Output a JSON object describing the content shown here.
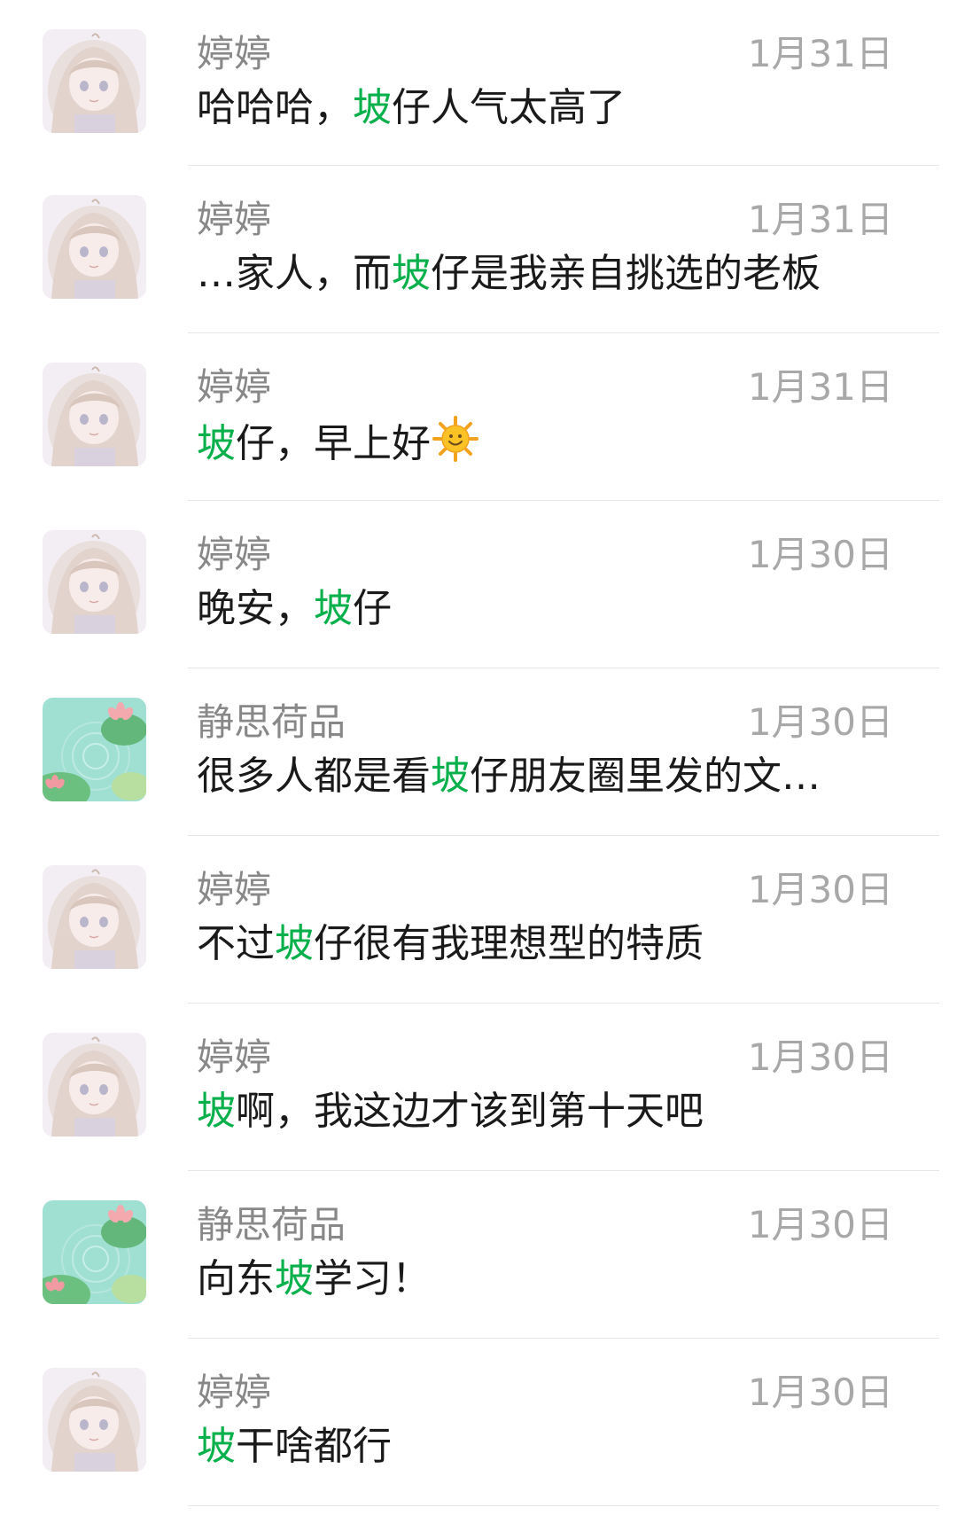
{
  "colors": {
    "highlight": "#07b04a",
    "name_text": "#888888",
    "date_text": "#a8a8a8",
    "message_text": "#1a1a1a",
    "divider": "#e6e6e6"
  },
  "results": [
    {
      "name": "婷婷",
      "date": "1月31日",
      "avatar": "girl-avatar-icon",
      "pre": "哈哈哈，",
      "hl": "坡",
      "post": "仔人气太高了",
      "emoji": ""
    },
    {
      "name": "婷婷",
      "date": "1月31日",
      "avatar": "girl-avatar-icon",
      "pre": "…家人，而",
      "hl": "坡",
      "post": "仔是我亲自挑选的老板",
      "emoji": ""
    },
    {
      "name": "婷婷",
      "date": "1月31日",
      "avatar": "girl-avatar-icon",
      "pre": "",
      "hl": "坡",
      "post": "仔，早上好",
      "emoji": "sun-with-face-icon"
    },
    {
      "name": "婷婷",
      "date": "1月30日",
      "avatar": "girl-avatar-icon",
      "pre": "晚安，",
      "hl": "坡",
      "post": "仔",
      "emoji": ""
    },
    {
      "name": "静思荷品",
      "date": "1月30日",
      "avatar": "lotus-avatar-icon",
      "pre": "很多人都是看",
      "hl": "坡",
      "post": "仔朋友圈里发的文…",
      "emoji": ""
    },
    {
      "name": "婷婷",
      "date": "1月30日",
      "avatar": "girl-avatar-icon",
      "pre": "不过",
      "hl": "坡",
      "post": "仔很有我理想型的特质",
      "emoji": ""
    },
    {
      "name": "婷婷",
      "date": "1月30日",
      "avatar": "girl-avatar-icon",
      "pre": "",
      "hl": "坡",
      "post": "啊，我这边才该到第十天吧",
      "emoji": ""
    },
    {
      "name": "静思荷品",
      "date": "1月30日",
      "avatar": "lotus-avatar-icon",
      "pre": "向东",
      "hl": "坡",
      "post": "学习！",
      "emoji": ""
    },
    {
      "name": "婷婷",
      "date": "1月30日",
      "avatar": "girl-avatar-icon",
      "pre": "",
      "hl": "坡",
      "post": "干啥都行",
      "emoji": ""
    }
  ]
}
